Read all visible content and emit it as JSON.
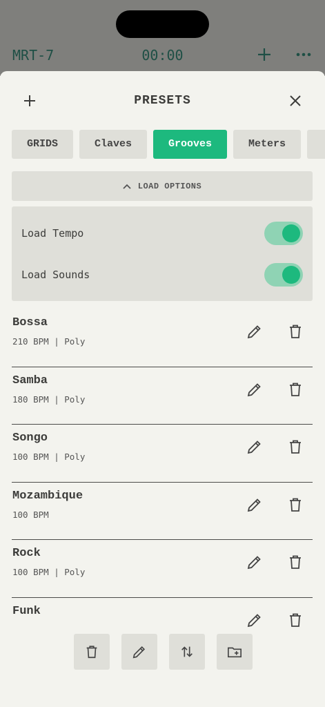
{
  "background_app": {
    "title": "MRT-7",
    "timer": "00:00"
  },
  "sheet": {
    "title": "PRESETS"
  },
  "tabs": [
    {
      "label": "GRIDS",
      "active": false
    },
    {
      "label": "Claves",
      "active": false
    },
    {
      "label": "Grooves",
      "active": true
    },
    {
      "label": "Meters",
      "active": false
    },
    {
      "label": "",
      "active": false
    }
  ],
  "load_options": {
    "label": "LOAD OPTIONS",
    "expanded": true,
    "items": [
      {
        "label": "Load Tempo",
        "enabled": true
      },
      {
        "label": "Load Sounds",
        "enabled": true
      }
    ]
  },
  "presets": [
    {
      "name": "Bossa",
      "info": "210 BPM | Poly"
    },
    {
      "name": "Samba",
      "info": "180 BPM | Poly"
    },
    {
      "name": "Songo",
      "info": "100 BPM | Poly"
    },
    {
      "name": "Mozambique",
      "info": "100 BPM"
    },
    {
      "name": "Rock",
      "info": "100 BPM | Poly"
    },
    {
      "name": "Funk",
      "info": ""
    }
  ],
  "colors": {
    "accent": "#1db97e",
    "toggle_track": "#8fd3b4",
    "surface": "#dfdfd9",
    "background": "#f3f3ee"
  }
}
